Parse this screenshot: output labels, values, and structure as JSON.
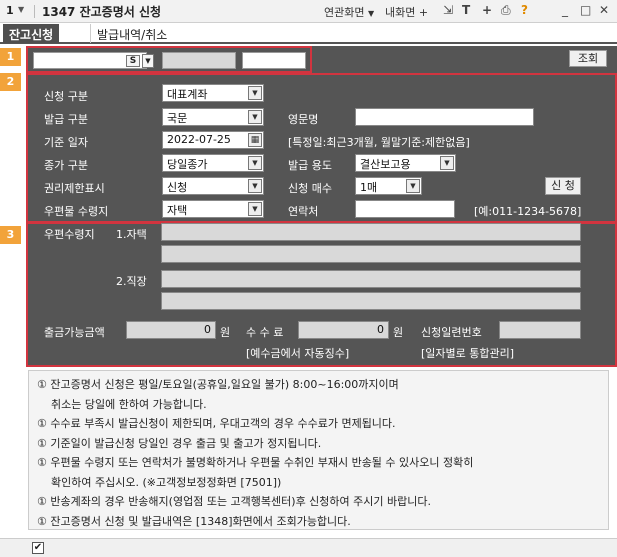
{
  "window": {
    "screen_no": "1",
    "title": "1347 잔고증명서 신청",
    "menus": [
      "연관화면",
      "내화면"
    ],
    "toolbar_icons": [
      "pin-icon",
      "text-icon",
      "plus-icon",
      "print-icon",
      "help-icon",
      "minimize-icon",
      "maximize-icon",
      "close-icon"
    ],
    "help_glyph": "?"
  },
  "tabs": [
    {
      "label": "잔고신청"
    },
    {
      "label": "발급내역/취소"
    }
  ],
  "markers": [
    "1",
    "2",
    "3"
  ],
  "top": {
    "s_label": "S",
    "lookup_label": "조회"
  },
  "form": {
    "apply_type_label": "신청 구분",
    "apply_type_value": "대표계좌",
    "issue_type_label": "발급 구분",
    "issue_type_value": "국문",
    "english_name_label": "영문명",
    "base_date_label": "기준 일자",
    "base_date_value": "2022-07-25",
    "base_date_note": "[특정일:최근3개월, 월말기준:제한없음]",
    "price_type_label": "종가 구분",
    "price_type_value": "당일종가",
    "purpose_label": "발급 용도",
    "purpose_value": "결산보고용",
    "rights_label": "권리제한표시",
    "rights_value": "신청",
    "copies_label": "신청 매수",
    "copies_value": "1매",
    "apply_button": "신 청",
    "mail_recv_label": "우편물 수령지",
    "mail_recv_value": "자택",
    "contact_label": "연락처",
    "contact_example": "[예:011-1234-5678]"
  },
  "address": {
    "label": "우편수령지",
    "home_label": "1.자택",
    "work_label": "2.직장"
  },
  "fees": {
    "withdrawable_label": "출금가능금액",
    "withdrawable_value": "0",
    "unit": "원",
    "fee_label": "수 수 료",
    "fee_value": "0",
    "fee_note": "[예수금에서 자동징수]",
    "serial_label": "신청일련번호",
    "serial_note": "[일자별로 통합관리]"
  },
  "notes": [
    {
      "text": "① 잔고증명서 신청은 평일/토요일(공휴일,일요일 불가) 8:00~16:00까지이며",
      "indent": false
    },
    {
      "text": "취소는 당일에 한하여 가능합니다.",
      "indent": true
    },
    {
      "text": "① 수수료 부족시 발급신청이 제한되며, 우대고객의 경우 수수료가 면제됩니다.",
      "indent": false
    },
    {
      "text": "① 기준일이 발급신청 당일인 경우 출금 및 출고가 정지됩니다.",
      "indent": false
    },
    {
      "text": "① 우편물 수령지 또는 연락처가 불명확하거나 우편물 수취인 부재시 반송될 수 있사오니 정확히",
      "indent": false
    },
    {
      "text": "확인하여 주십시오. (※고객정보정정화면 [7501])",
      "indent": true
    },
    {
      "text": "① 반송계좌의 경우 반송해지(영업점 또는 고객행복센터)후 신청하여 주시기 바랍니다.",
      "indent": false
    },
    {
      "text": "① 잔고증명서 신청 및 발급내역은 [1348]화면에서 조회가능합니다.",
      "indent": false
    }
  ],
  "footer": {
    "check_glyph": "✔"
  }
}
